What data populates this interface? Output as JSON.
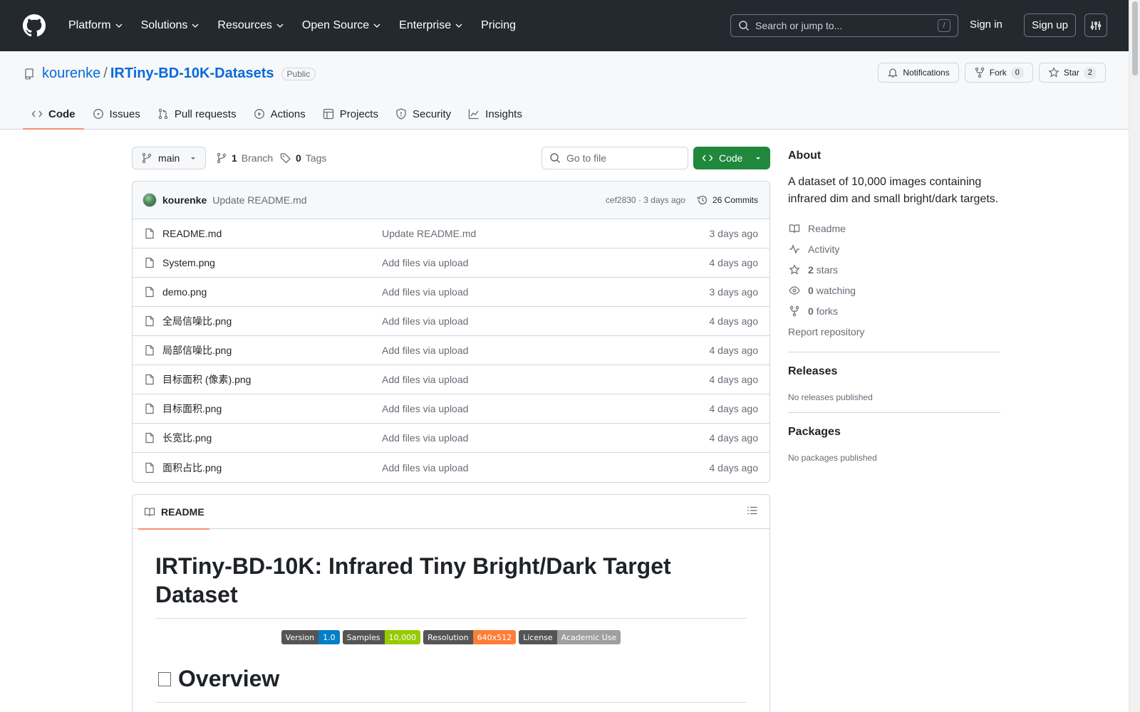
{
  "header": {
    "nav": [
      "Platform",
      "Solutions",
      "Resources",
      "Open Source",
      "Enterprise",
      "Pricing"
    ],
    "search_placeholder": "Search or jump to...",
    "search_shortcut": "/",
    "signin": "Sign in",
    "signup": "Sign up"
  },
  "repo": {
    "owner": "kourenke",
    "separator": "/",
    "name": "IRTiny-BD-10K-Datasets",
    "visibility": "Public",
    "actions": {
      "notifications": "Notifications",
      "fork": "Fork",
      "fork_count": "0",
      "star": "Star",
      "star_count": "2"
    },
    "tabs": [
      "Code",
      "Issues",
      "Pull requests",
      "Actions",
      "Projects",
      "Security",
      "Insights"
    ]
  },
  "toolbar": {
    "branch": "main",
    "branches_count": "1",
    "branches_label": "Branch",
    "tags_count": "0",
    "tags_label": "Tags",
    "goto_placeholder": "Go to file",
    "code_button": "Code"
  },
  "latest_commit": {
    "author": "kourenke",
    "message": "Update README.md",
    "hash_time": "cef2830 · 3 days ago",
    "commits": "26 Commits"
  },
  "files": [
    {
      "name": "README.md",
      "message": "Update README.md",
      "age": "3 days ago"
    },
    {
      "name": "System.png",
      "message": "Add files via upload",
      "age": "4 days ago"
    },
    {
      "name": "demo.png",
      "message": "Add files via upload",
      "age": "3 days ago"
    },
    {
      "name": "全局信噪比.png",
      "message": "Add files via upload",
      "age": "4 days ago"
    },
    {
      "name": "局部信噪比.png",
      "message": "Add files via upload",
      "age": "4 days ago"
    },
    {
      "name": "目标面积 (像素).png",
      "message": "Add files via upload",
      "age": "4 days ago"
    },
    {
      "name": "目标面积.png",
      "message": "Add files via upload",
      "age": "4 days ago"
    },
    {
      "name": "长宽比.png",
      "message": "Add files via upload",
      "age": "4 days ago"
    },
    {
      "name": "面积占比.png",
      "message": "Add files via upload",
      "age": "4 days ago"
    }
  ],
  "readme": {
    "tab": "README",
    "title": "IRTiny-BD-10K: Infrared Tiny Bright/Dark Target Dataset",
    "badges": [
      {
        "label": "Version",
        "value": "1.0",
        "color": "#007ec6"
      },
      {
        "label": "Samples",
        "value": "10,000",
        "color": "#97ca00"
      },
      {
        "label": "Resolution",
        "value": "640x512",
        "color": "#fe7d37"
      },
      {
        "label": "License",
        "value": "Academic Use",
        "color": "#9f9f9f"
      }
    ],
    "overview": "Overview"
  },
  "sidebar": {
    "about_title": "About",
    "description": "A dataset of 10,000 images containing infrared dim and small bright/dark targets.",
    "readme": "Readme",
    "activity": "Activity",
    "stars_count": "2",
    "stars_label": "stars",
    "watching_count": "0",
    "watching_label": "watching",
    "forks_count": "0",
    "forks_label": "forks",
    "report": "Report repository",
    "releases_title": "Releases",
    "releases_empty": "No releases published",
    "packages_title": "Packages",
    "packages_empty": "No packages published"
  },
  "colors": {
    "header_bg": "#24292f",
    "link": "#0969da",
    "code_button": "#1f883d",
    "tab_underline": "#fd8c73"
  }
}
